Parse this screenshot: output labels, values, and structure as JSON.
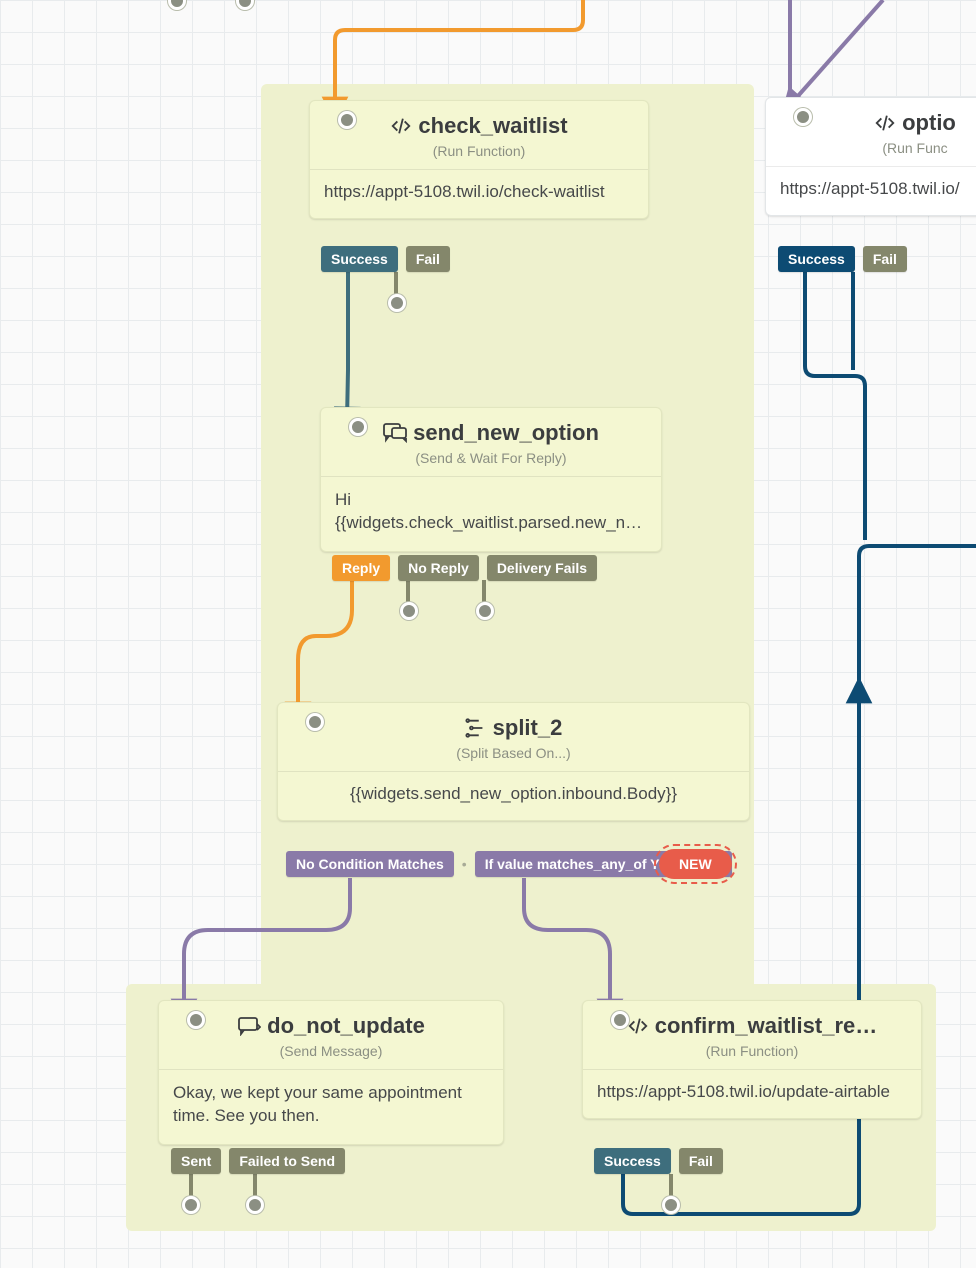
{
  "colors": {
    "orange": "#f29a2e",
    "teal": "#3e6e7d",
    "purple": "#8a7aa8",
    "navy": "#0d4b73"
  },
  "widgets": {
    "check_waitlist": {
      "title": "check_waitlist",
      "type": "(Run Function)",
      "body": "https://appt-5108.twil.io/check-waitlist",
      "tags": {
        "success": "Success",
        "fail": "Fail"
      }
    },
    "option": {
      "title": "optio",
      "type": "(Run Func",
      "body": "https://appt-5108.twil.io/",
      "tags": {
        "success": "Success",
        "fail": "Fail"
      }
    },
    "send_new_option": {
      "title": "send_new_option",
      "type": "(Send & Wait For Reply)",
      "body": "Hi {{widgets.check_waitlist.parsed.new_name…",
      "tags": {
        "reply": "Reply",
        "noreply": "No Reply",
        "delivery": "Delivery Fails"
      }
    },
    "split_2": {
      "title": "split_2",
      "type": "(Split Based On...)",
      "body": "{{widgets.send_new_option.inbound.Body}}",
      "tags": {
        "nomatch": "No Condition Matches",
        "match": "If value matches_any_of Yes, yes, Y"
      },
      "new": "NEW"
    },
    "do_not_update": {
      "title": "do_not_update",
      "type": "(Send Message)",
      "body": "Okay, we kept your same appointment time. See you then.",
      "tags": {
        "sent": "Sent",
        "failed": "Failed to Send"
      }
    },
    "confirm_waitlist": {
      "title": "confirm_waitlist_re…",
      "type": "(Run Function)",
      "body": "https://appt-5108.twil.io/update-airtable",
      "tags": {
        "success": "Success",
        "fail": "Fail"
      }
    }
  }
}
